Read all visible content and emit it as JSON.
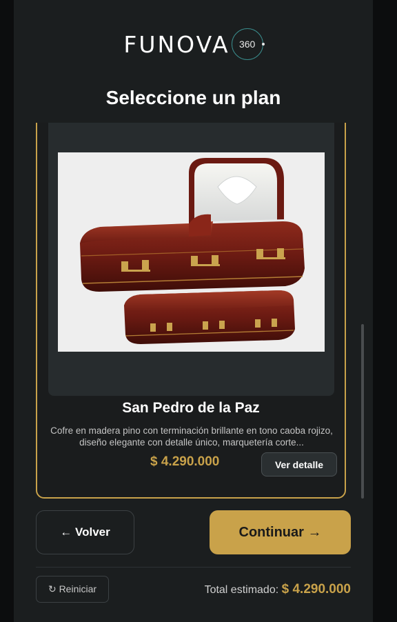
{
  "brand": {
    "name": "FUNOVA",
    "suffix": "360"
  },
  "page_title": "Seleccione un plan",
  "plan": {
    "name": "San Pedro de la Paz",
    "description": "Cofre en madera pino con terminación brillante en tono caoba rojizo, diseño elegante con detalle único, marquetería corte...",
    "price": "$ 4.290.000",
    "detail_label": "Ver detalle"
  },
  "nav": {
    "back_label": "← Volver",
    "continue_label": "Continuar →"
  },
  "footer": {
    "reset_label": "↻ Reiniciar",
    "total_label": "Total estimado:",
    "total_value": "$ 4.290.000"
  },
  "colors": {
    "accent": "#c9a24a",
    "panel": "#1b1e1f",
    "background": "#0c0d0e"
  }
}
